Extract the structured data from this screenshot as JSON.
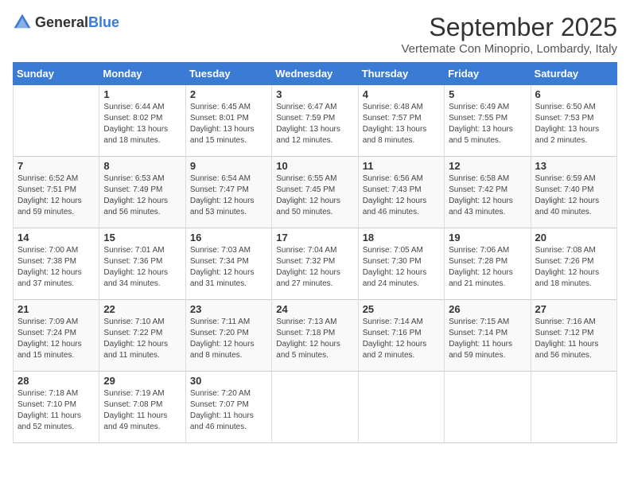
{
  "header": {
    "logo_general": "General",
    "logo_blue": "Blue",
    "month_title": "September 2025",
    "subtitle": "Vertemate Con Minoprio, Lombardy, Italy"
  },
  "weekdays": [
    "Sunday",
    "Monday",
    "Tuesday",
    "Wednesday",
    "Thursday",
    "Friday",
    "Saturday"
  ],
  "weeks": [
    [
      {
        "day": "",
        "sunrise": "",
        "sunset": "",
        "daylight": ""
      },
      {
        "day": "1",
        "sunrise": "Sunrise: 6:44 AM",
        "sunset": "Sunset: 8:02 PM",
        "daylight": "Daylight: 13 hours and 18 minutes."
      },
      {
        "day": "2",
        "sunrise": "Sunrise: 6:45 AM",
        "sunset": "Sunset: 8:01 PM",
        "daylight": "Daylight: 13 hours and 15 minutes."
      },
      {
        "day": "3",
        "sunrise": "Sunrise: 6:47 AM",
        "sunset": "Sunset: 7:59 PM",
        "daylight": "Daylight: 13 hours and 12 minutes."
      },
      {
        "day": "4",
        "sunrise": "Sunrise: 6:48 AM",
        "sunset": "Sunset: 7:57 PM",
        "daylight": "Daylight: 13 hours and 8 minutes."
      },
      {
        "day": "5",
        "sunrise": "Sunrise: 6:49 AM",
        "sunset": "Sunset: 7:55 PM",
        "daylight": "Daylight: 13 hours and 5 minutes."
      },
      {
        "day": "6",
        "sunrise": "Sunrise: 6:50 AM",
        "sunset": "Sunset: 7:53 PM",
        "daylight": "Daylight: 13 hours and 2 minutes."
      }
    ],
    [
      {
        "day": "7",
        "sunrise": "Sunrise: 6:52 AM",
        "sunset": "Sunset: 7:51 PM",
        "daylight": "Daylight: 12 hours and 59 minutes."
      },
      {
        "day": "8",
        "sunrise": "Sunrise: 6:53 AM",
        "sunset": "Sunset: 7:49 PM",
        "daylight": "Daylight: 12 hours and 56 minutes."
      },
      {
        "day": "9",
        "sunrise": "Sunrise: 6:54 AM",
        "sunset": "Sunset: 7:47 PM",
        "daylight": "Daylight: 12 hours and 53 minutes."
      },
      {
        "day": "10",
        "sunrise": "Sunrise: 6:55 AM",
        "sunset": "Sunset: 7:45 PM",
        "daylight": "Daylight: 12 hours and 50 minutes."
      },
      {
        "day": "11",
        "sunrise": "Sunrise: 6:56 AM",
        "sunset": "Sunset: 7:43 PM",
        "daylight": "Daylight: 12 hours and 46 minutes."
      },
      {
        "day": "12",
        "sunrise": "Sunrise: 6:58 AM",
        "sunset": "Sunset: 7:42 PM",
        "daylight": "Daylight: 12 hours and 43 minutes."
      },
      {
        "day": "13",
        "sunrise": "Sunrise: 6:59 AM",
        "sunset": "Sunset: 7:40 PM",
        "daylight": "Daylight: 12 hours and 40 minutes."
      }
    ],
    [
      {
        "day": "14",
        "sunrise": "Sunrise: 7:00 AM",
        "sunset": "Sunset: 7:38 PM",
        "daylight": "Daylight: 12 hours and 37 minutes."
      },
      {
        "day": "15",
        "sunrise": "Sunrise: 7:01 AM",
        "sunset": "Sunset: 7:36 PM",
        "daylight": "Daylight: 12 hours and 34 minutes."
      },
      {
        "day": "16",
        "sunrise": "Sunrise: 7:03 AM",
        "sunset": "Sunset: 7:34 PM",
        "daylight": "Daylight: 12 hours and 31 minutes."
      },
      {
        "day": "17",
        "sunrise": "Sunrise: 7:04 AM",
        "sunset": "Sunset: 7:32 PM",
        "daylight": "Daylight: 12 hours and 27 minutes."
      },
      {
        "day": "18",
        "sunrise": "Sunrise: 7:05 AM",
        "sunset": "Sunset: 7:30 PM",
        "daylight": "Daylight: 12 hours and 24 minutes."
      },
      {
        "day": "19",
        "sunrise": "Sunrise: 7:06 AM",
        "sunset": "Sunset: 7:28 PM",
        "daylight": "Daylight: 12 hours and 21 minutes."
      },
      {
        "day": "20",
        "sunrise": "Sunrise: 7:08 AM",
        "sunset": "Sunset: 7:26 PM",
        "daylight": "Daylight: 12 hours and 18 minutes."
      }
    ],
    [
      {
        "day": "21",
        "sunrise": "Sunrise: 7:09 AM",
        "sunset": "Sunset: 7:24 PM",
        "daylight": "Daylight: 12 hours and 15 minutes."
      },
      {
        "day": "22",
        "sunrise": "Sunrise: 7:10 AM",
        "sunset": "Sunset: 7:22 PM",
        "daylight": "Daylight: 12 hours and 11 minutes."
      },
      {
        "day": "23",
        "sunrise": "Sunrise: 7:11 AM",
        "sunset": "Sunset: 7:20 PM",
        "daylight": "Daylight: 12 hours and 8 minutes."
      },
      {
        "day": "24",
        "sunrise": "Sunrise: 7:13 AM",
        "sunset": "Sunset: 7:18 PM",
        "daylight": "Daylight: 12 hours and 5 minutes."
      },
      {
        "day": "25",
        "sunrise": "Sunrise: 7:14 AM",
        "sunset": "Sunset: 7:16 PM",
        "daylight": "Daylight: 12 hours and 2 minutes."
      },
      {
        "day": "26",
        "sunrise": "Sunrise: 7:15 AM",
        "sunset": "Sunset: 7:14 PM",
        "daylight": "Daylight: 11 hours and 59 minutes."
      },
      {
        "day": "27",
        "sunrise": "Sunrise: 7:16 AM",
        "sunset": "Sunset: 7:12 PM",
        "daylight": "Daylight: 11 hours and 56 minutes."
      }
    ],
    [
      {
        "day": "28",
        "sunrise": "Sunrise: 7:18 AM",
        "sunset": "Sunset: 7:10 PM",
        "daylight": "Daylight: 11 hours and 52 minutes."
      },
      {
        "day": "29",
        "sunrise": "Sunrise: 7:19 AM",
        "sunset": "Sunset: 7:08 PM",
        "daylight": "Daylight: 11 hours and 49 minutes."
      },
      {
        "day": "30",
        "sunrise": "Sunrise: 7:20 AM",
        "sunset": "Sunset: 7:07 PM",
        "daylight": "Daylight: 11 hours and 46 minutes."
      },
      {
        "day": "",
        "sunrise": "",
        "sunset": "",
        "daylight": ""
      },
      {
        "day": "",
        "sunrise": "",
        "sunset": "",
        "daylight": ""
      },
      {
        "day": "",
        "sunrise": "",
        "sunset": "",
        "daylight": ""
      },
      {
        "day": "",
        "sunrise": "",
        "sunset": "",
        "daylight": ""
      }
    ]
  ]
}
